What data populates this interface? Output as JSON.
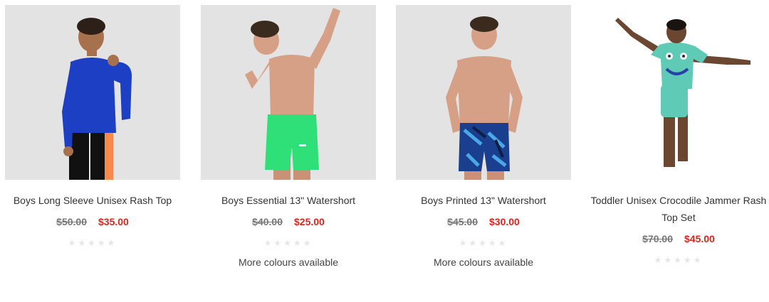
{
  "products": [
    {
      "title": "Boys Long Sleeve Unisex Rash Top",
      "old_price": "$50.00",
      "new_price": "$35.00",
      "rating_stars": "★★★★★",
      "colours_note": ""
    },
    {
      "title": "Boys Essential 13\" Watershort",
      "old_price": "$40.00",
      "new_price": "$25.00",
      "rating_stars": "★★★★★",
      "colours_note": "More colours available"
    },
    {
      "title": "Boys Printed 13\" Watershort",
      "old_price": "$45.00",
      "new_price": "$30.00",
      "rating_stars": "★★★★★",
      "colours_note": "More colours available"
    },
    {
      "title": "Toddler Unisex Crocodile Jammer Rash Top Set",
      "old_price": "$70.00",
      "new_price": "$45.00",
      "rating_stars": "★★★★★",
      "colours_note": ""
    }
  ],
  "colors": {
    "sale_price": "#e0241b",
    "old_price": "#777777",
    "image_bg": "#e3e3e3",
    "star_empty": "#e6e6e6"
  },
  "icons": {
    "rating": "star-icon"
  }
}
